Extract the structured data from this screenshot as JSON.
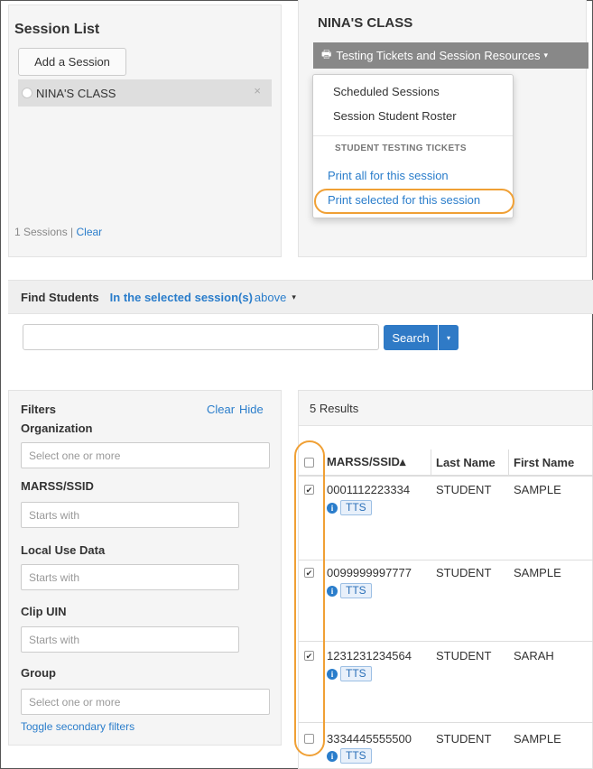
{
  "session_list": {
    "title": "Session List",
    "add_button": "Add a Session",
    "items": [
      {
        "name": "NINA'S CLASS",
        "remove_glyph": "×"
      }
    ],
    "count_text": "1 Sessions |",
    "clear_link": "Clear"
  },
  "class_panel": {
    "title": "NINA'S CLASS",
    "resources_button": "Testing Tickets and Session Resources",
    "printer_glyph": "🖶",
    "caret_glyph": "▾"
  },
  "dropdown": {
    "items": [
      "Scheduled Sessions",
      "Session Student Roster"
    ],
    "section_header": "STUDENT TESTING TICKETS",
    "links": [
      "Print all for this session",
      "Print selected for this session"
    ]
  },
  "find_students": {
    "label": "Find Students",
    "scope": "In the selected session(s)",
    "scope_tail": "above",
    "caret_glyph": "▾",
    "search_value": "",
    "search_button": "Search",
    "search_caret": "▾"
  },
  "filters": {
    "title": "Filters",
    "clear_link": "Clear",
    "hide_link": "Hide",
    "organization_label": "Organization",
    "organization_placeholder": "Select one or more",
    "marss_label": "MARSS/SSID",
    "marss_placeholder": "Starts with",
    "local_label": "Local Use Data",
    "local_placeholder": "Starts with",
    "clip_label": "Clip UIN",
    "clip_placeholder": "Starts with",
    "group_label": "Group",
    "group_placeholder": "Select one or more",
    "toggle_link": "Toggle secondary filters"
  },
  "results": {
    "count_text": "5 Results",
    "columns": [
      "MARSS/SSID▴",
      "Last Name",
      "First Name"
    ],
    "rows": [
      {
        "id": "0001112223334",
        "last": "STUDENT",
        "first": "SAMPLE",
        "checked": true,
        "badge": "TTS"
      },
      {
        "id": "0099999997777",
        "last": "STUDENT",
        "first": "SAMPLE",
        "checked": true,
        "badge": "TTS"
      },
      {
        "id": "1231231234564",
        "last": "STUDENT",
        "first": "SARAH",
        "checked": true,
        "badge": "TTS"
      },
      {
        "id": "3334445555500",
        "last": "STUDENT",
        "first": "SAMPLE",
        "checked": false,
        "badge": "TTS"
      }
    ],
    "info_glyph": "i",
    "check_glyph": "✔"
  },
  "colors": {
    "link": "#2a7dcb",
    "primary_button": "#2f7ac6",
    "highlight": "#f0a035",
    "resources_button": "#888888"
  }
}
